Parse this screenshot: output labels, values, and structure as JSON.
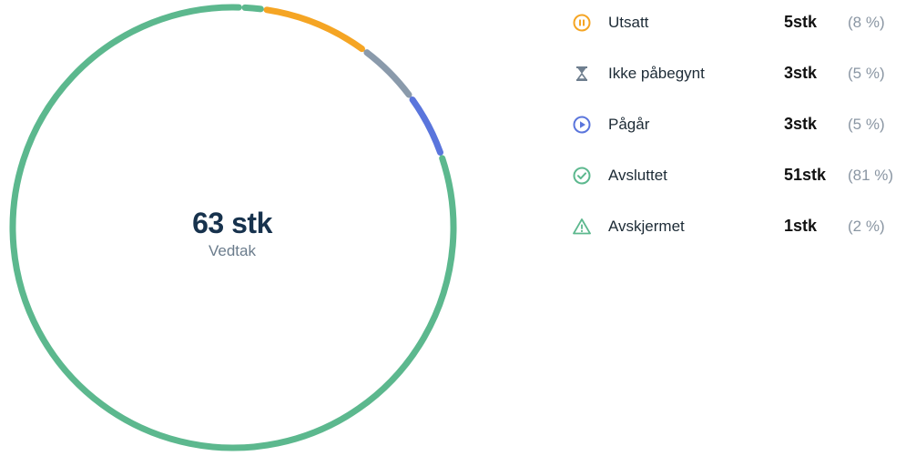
{
  "summary": {
    "total": "63 stk",
    "subtitle": "Vedtak"
  },
  "chart_data": {
    "type": "pie",
    "variant": "donut",
    "total": 63,
    "start_angle_deg": 8,
    "series": [
      {
        "name": "Utsatt",
        "value": 5,
        "color": "#f5a524"
      },
      {
        "name": "Ikke påbegynt",
        "value": 3,
        "color": "#8a9aab"
      },
      {
        "name": "Pågår",
        "value": 3,
        "color": "#5a75dc"
      },
      {
        "name": "Avsluttet",
        "value": 51,
        "color": "#5cb88e"
      },
      {
        "name": "Avskjermet",
        "value": 1,
        "color": "#5cb88e"
      }
    ]
  },
  "legend": [
    {
      "label": "Utsatt",
      "count": "5stk",
      "percent": "(8 %)",
      "icon": "pause-circle-icon",
      "color": "#f5a524"
    },
    {
      "label": "Ikke påbegynt",
      "count": "3stk",
      "percent": "(5 %)",
      "icon": "hourglass-icon",
      "color": "#6f7f8f"
    },
    {
      "label": "Pågår",
      "count": "3stk",
      "percent": "(5 %)",
      "icon": "play-circle-icon",
      "color": "#5a75dc"
    },
    {
      "label": "Avsluttet",
      "count": "51stk",
      "percent": "(81 %)",
      "icon": "check-circle-icon",
      "color": "#5cb88e"
    },
    {
      "label": "Avskjermet",
      "count": "1stk",
      "percent": "(2 %)",
      "icon": "warning-triangle-icon",
      "color": "#5cb88e"
    }
  ]
}
